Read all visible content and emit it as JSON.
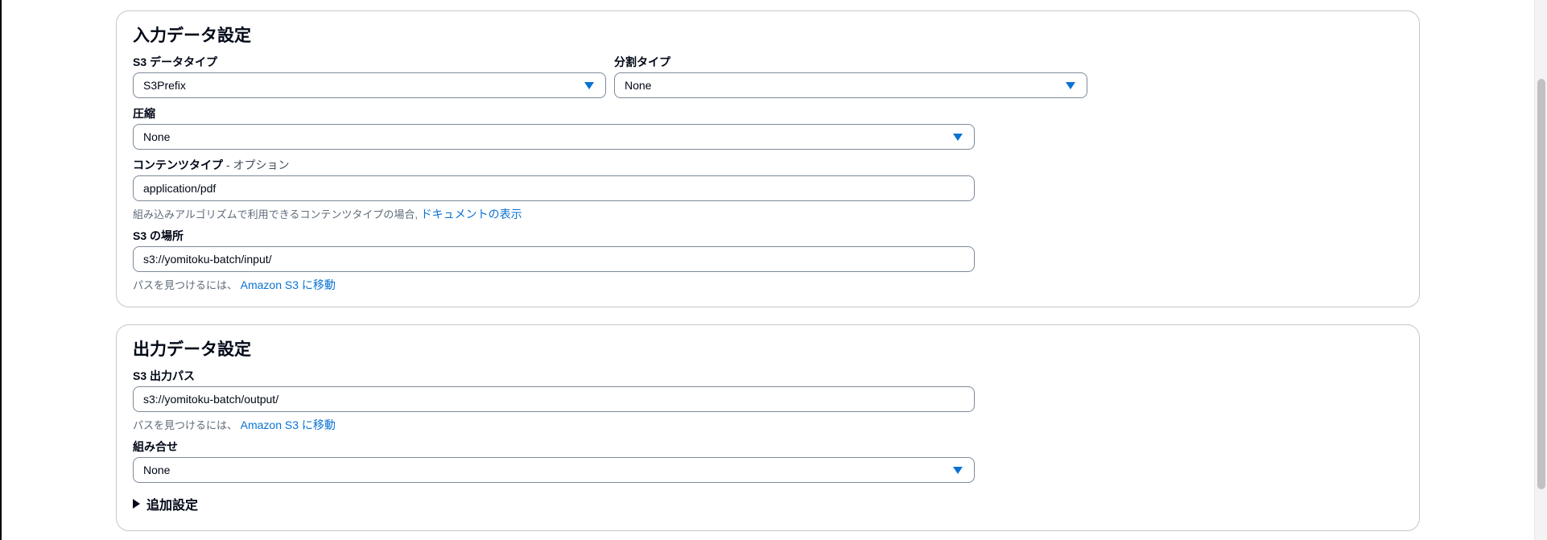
{
  "input_section": {
    "title": "入力データ設定",
    "s3_data_type": {
      "label": "S3 データタイプ",
      "value": "S3Prefix"
    },
    "split_type": {
      "label": "分割タイプ",
      "value": "None"
    },
    "compression": {
      "label": "圧縮",
      "value": "None"
    },
    "content_type": {
      "label": "コンテンツタイプ",
      "optional_suffix": " - オプション",
      "value": "application/pdf",
      "hint": "組み込みアルゴリズムで利用できるコンテンツタイプの場合, ",
      "hint_link": "ドキュメントの表示"
    },
    "s3_location": {
      "label": "S3 の場所",
      "value": "s3://yomitoku-batch/input/",
      "hint": "パスを見つけるには、 ",
      "hint_link": "Amazon S3 に移動"
    }
  },
  "output_section": {
    "title": "出力データ設定",
    "s3_output_path": {
      "label": "S3 出力パス",
      "value": "s3://yomitoku-batch/output/",
      "hint": "パスを見つけるには、 ",
      "hint_link": "Amazon S3 に移動"
    },
    "assemble": {
      "label": "組み合せ",
      "value": "None"
    },
    "additional_settings": {
      "label": "追加設定"
    }
  },
  "colors": {
    "link": "#0972d3",
    "border": "#7d8998",
    "panel_border": "#c6c6cd",
    "text": "#000716",
    "hint": "#5f6b7a"
  },
  "icons": {
    "dropdown": "caret-down-icon",
    "expander": "caret-right-icon"
  }
}
